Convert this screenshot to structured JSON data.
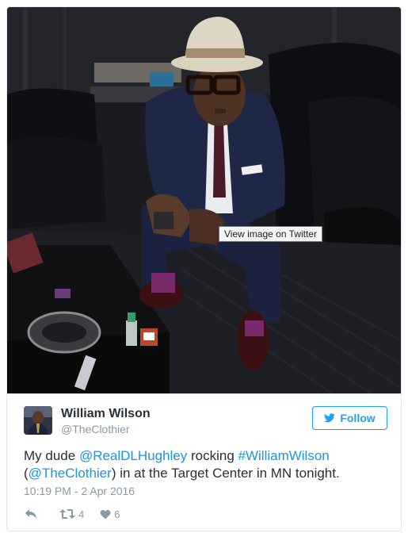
{
  "media": {
    "tooltip": "View image on Twitter"
  },
  "author": {
    "display_name": "William Wilson",
    "screen_name": "@TheClothier"
  },
  "follow": {
    "label": "Follow",
    "color": "#1da1f2"
  },
  "tweet": {
    "text_before": "My dude ",
    "mention1": "@RealDLHughley",
    "text_mid1": " rocking ",
    "hashtag": "#WilliamWilson",
    "text_mid2": " (",
    "mention2": "@TheClothier",
    "text_after": ") in at the Target Center in MN tonight.",
    "link_color": "#1b95e0"
  },
  "timestamp": "10:19 PM - 2 Apr 2016",
  "actions": {
    "reply_icon": "reply-icon",
    "retweet_icon": "retweet-icon",
    "retweet_count": "4",
    "like_icon": "heart-icon",
    "like_count": "6"
  }
}
